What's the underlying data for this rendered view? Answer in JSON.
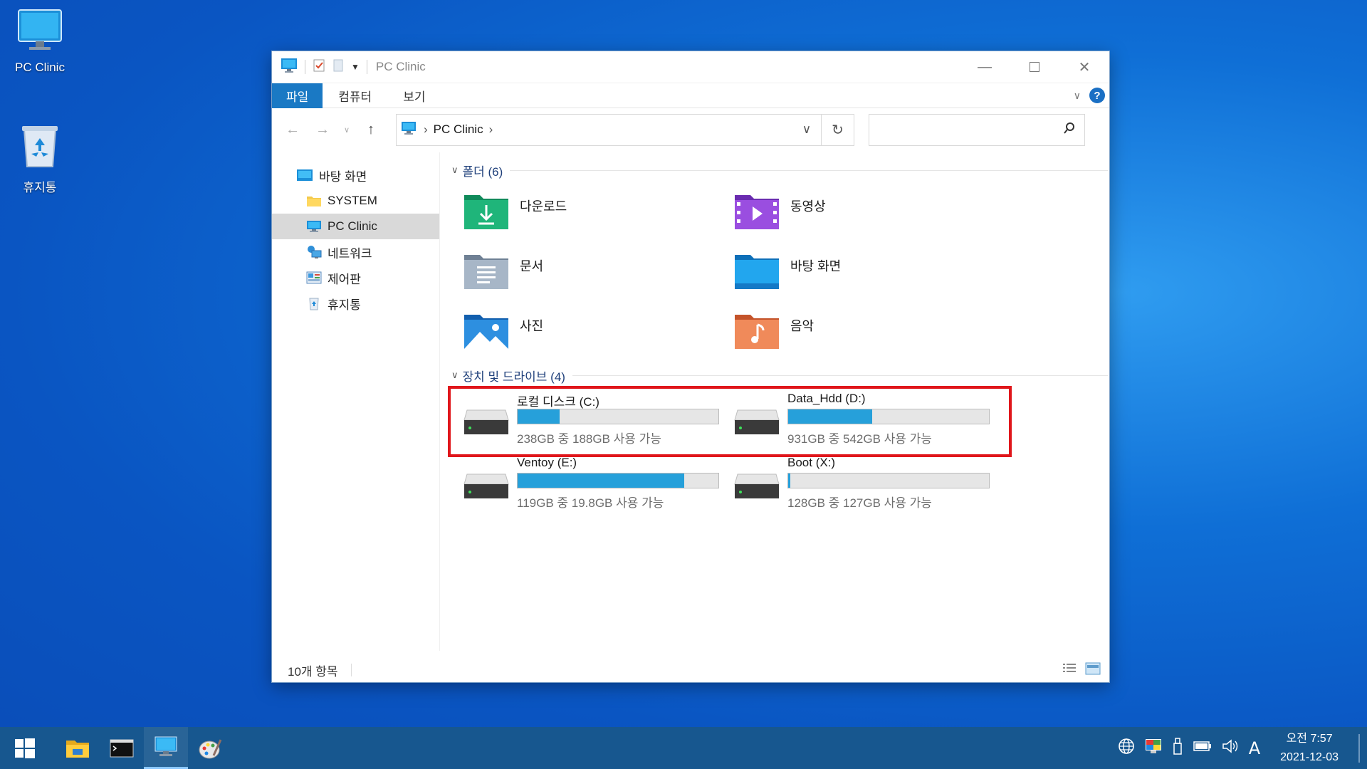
{
  "desktop": {
    "icons": [
      {
        "label": "PC Clinic",
        "icon": "computer-icon"
      },
      {
        "label": "휴지통",
        "icon": "recycle-bin-icon"
      }
    ]
  },
  "window": {
    "title": "PC Clinic",
    "ribbon_tabs": [
      "파일",
      "컴퓨터",
      "보기"
    ],
    "address": {
      "crumb": "PC Clinic"
    },
    "sidebar": [
      {
        "label": "바탕 화면",
        "icon": "desktop-icon"
      },
      {
        "label": "SYSTEM",
        "icon": "folder-icon"
      },
      {
        "label": "PC Clinic",
        "icon": "computer-icon",
        "selected": true
      },
      {
        "label": "네트워크",
        "icon": "network-icon"
      },
      {
        "label": "제어판",
        "icon": "control-panel-icon"
      },
      {
        "label": "휴지통",
        "icon": "recycle-bin-icon"
      }
    ],
    "groups": {
      "folders": "폴더 (6)",
      "drives": "장치 및 드라이브 (4)"
    },
    "folders": [
      {
        "label": "다운로드",
        "icon": "download-folder-icon",
        "color": "#1aa46e"
      },
      {
        "label": "동영상",
        "icon": "video-folder-icon",
        "color": "#8a3fd1"
      },
      {
        "label": "문서",
        "icon": "documents-folder-icon",
        "color": "#8fa2b8"
      },
      {
        "label": "바탕 화면",
        "icon": "desktop-folder-icon",
        "color": "#1a8fd6"
      },
      {
        "label": "사진",
        "icon": "pictures-folder-icon",
        "color": "#1f7fd6"
      },
      {
        "label": "음악",
        "icon": "music-folder-icon",
        "color": "#e0703c"
      }
    ],
    "drives": [
      {
        "name": "로컬 디스크 (C:)",
        "free_text": "238GB 중 188GB 사용 가능",
        "used_fraction": 0.21
      },
      {
        "name": "Data_Hdd (D:)",
        "free_text": "931GB 중 542GB 사용 가능",
        "used_fraction": 0.42
      },
      {
        "name": "Ventoy (E:)",
        "free_text": "119GB 중 19.8GB 사용 가능",
        "used_fraction": 0.83
      },
      {
        "name": "Boot (X:)",
        "free_text": "128GB 중 127GB 사용 가능",
        "used_fraction": 0.01
      }
    ],
    "status": "10개 항목"
  },
  "taskbar": {
    "clock_time": "오전 7:57",
    "clock_date": "2021-12-03",
    "ime": "A"
  },
  "colors": {
    "accent": "#1a79c4",
    "progress": "#26a0da",
    "highlight": "#e0161b"
  }
}
